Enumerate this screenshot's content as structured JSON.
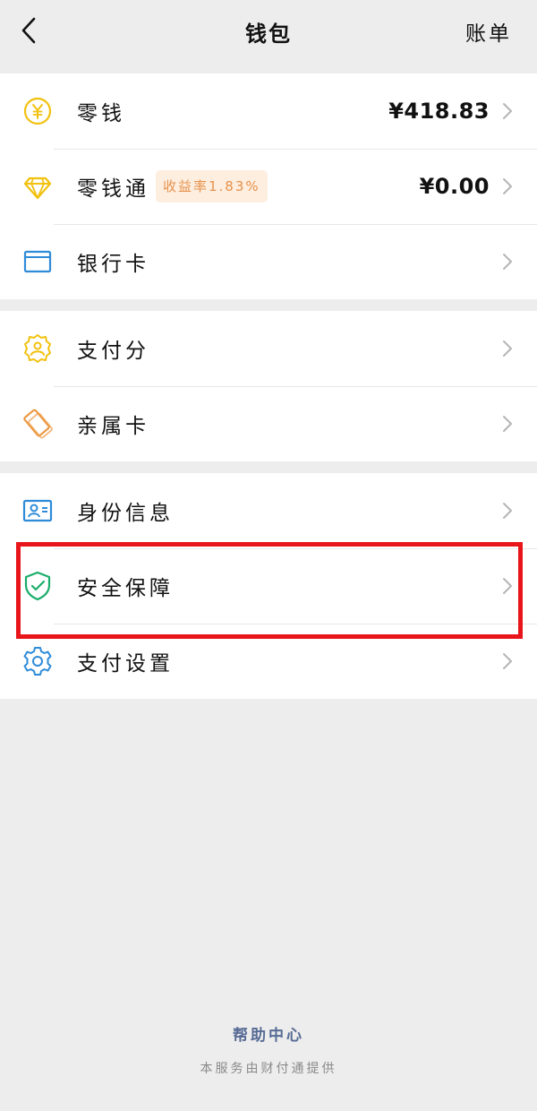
{
  "header": {
    "title": "钱包",
    "action": "账单"
  },
  "groups": [
    {
      "items": [
        {
          "label": "零钱",
          "icon": "yen-coin-icon",
          "value": "¥418.83"
        },
        {
          "label": "零钱通",
          "icon": "diamond-icon",
          "badge": "收益率1.83%",
          "value": "¥0.00"
        },
        {
          "label": "银行卡",
          "icon": "bank-card-icon"
        }
      ]
    },
    {
      "items": [
        {
          "label": "支付分",
          "icon": "pay-score-icon"
        },
        {
          "label": "亲属卡",
          "icon": "family-card-icon"
        }
      ]
    },
    {
      "items": [
        {
          "label": "身份信息",
          "icon": "id-card-icon"
        },
        {
          "label": "安全保障",
          "icon": "shield-check-icon"
        },
        {
          "label": "支付设置",
          "icon": "gear-icon"
        }
      ]
    }
  ],
  "footer": {
    "help_link": "帮助中心",
    "note": "本服务由财付通提供"
  },
  "colors": {
    "background": "#ededed",
    "card": "#ffffff",
    "highlight": "#e8161b",
    "link": "#576b95",
    "badge_bg": "#fdeee0",
    "badge_text": "#e7914a"
  }
}
